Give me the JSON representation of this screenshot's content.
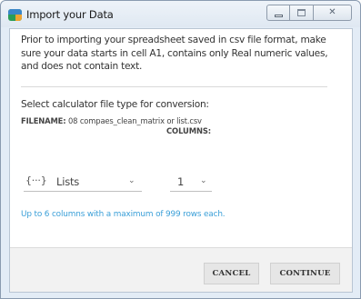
{
  "window": {
    "title": "Import your Data",
    "icon": "app-logo-icon"
  },
  "titlebar_controls": {
    "minimize": "minimize-icon",
    "maximize": "maximize-icon",
    "close_label": "✕"
  },
  "dialog": {
    "intro": "Prior to importing your spreadsheet saved in csv file format, make sure your data starts in cell A1, contains only Real numeric values, and does not contain text.",
    "select_type_label": "Select calculator file type for conversion:",
    "filename_label": "FILENAME:",
    "filename_value": "08 compaes_clean_matrix or list.csv",
    "columns_label": "COLUMNS:",
    "type_dropdown": {
      "icon": "{···}",
      "selected": "Lists"
    },
    "columns_dropdown": {
      "selected": "1"
    },
    "limit_note": "Up to 6 columns with a maximum of 999 rows each."
  },
  "footer": {
    "cancel_label": "CANCEL",
    "continue_label": "CONTINUE"
  },
  "colors": {
    "accent_link": "#3a9fd8",
    "window_frame": "#e3ecf6",
    "button_bg": "#e6e6e6"
  }
}
